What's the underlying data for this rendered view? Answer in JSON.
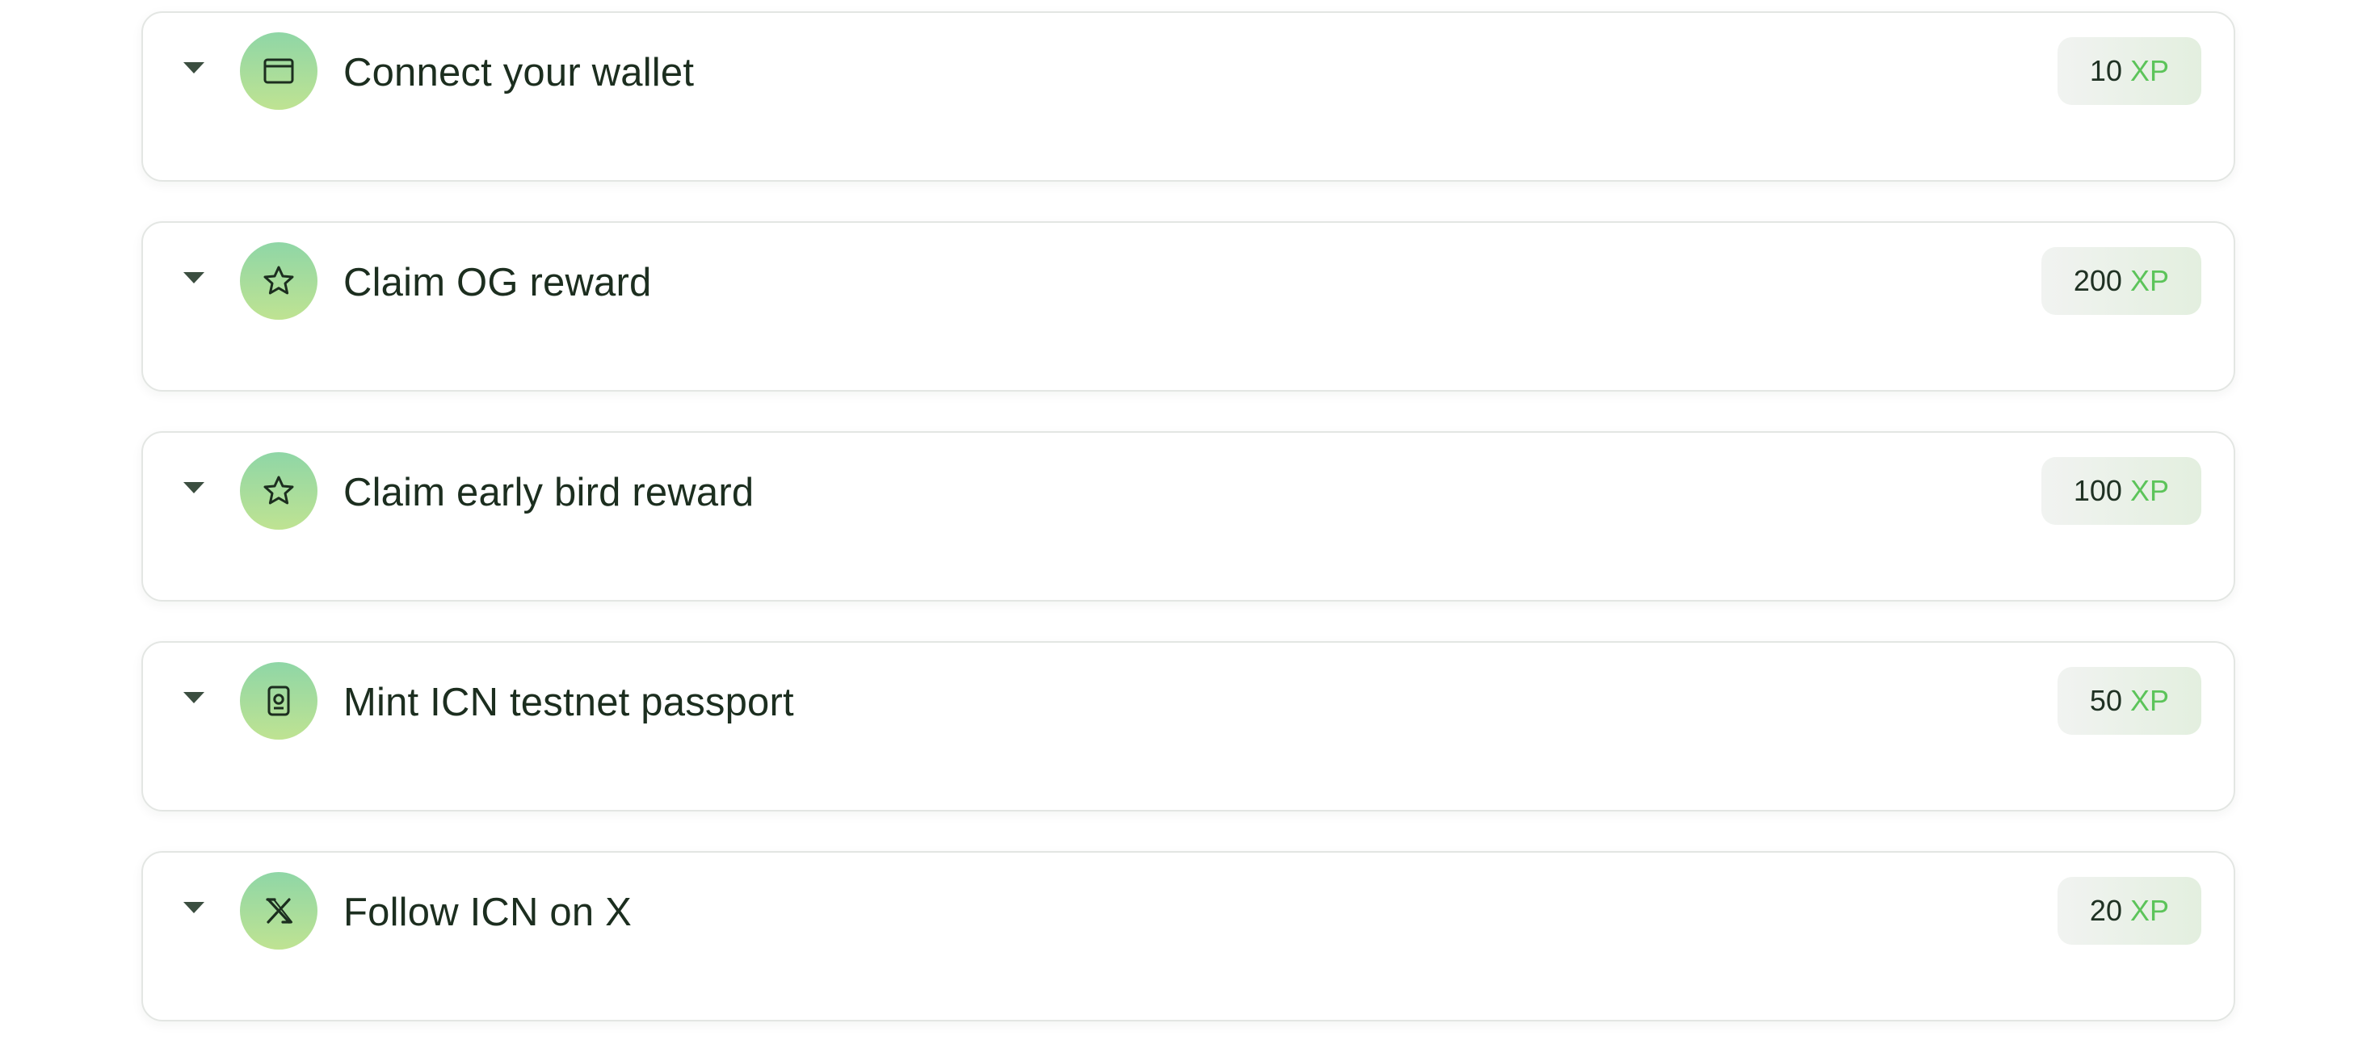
{
  "quests": [
    {
      "title": "Connect your wallet",
      "icon": "wallet-icon",
      "xp_amount": "10",
      "xp_unit": "XP"
    },
    {
      "title": "Claim OG reward",
      "icon": "star-icon",
      "xp_amount": "200",
      "xp_unit": "XP"
    },
    {
      "title": "Claim early bird reward",
      "icon": "star-icon",
      "xp_amount": "100",
      "xp_unit": "XP"
    },
    {
      "title": "Mint ICN testnet passport",
      "icon": "passport-icon",
      "xp_amount": "50",
      "xp_unit": "XP"
    },
    {
      "title": "Follow ICN on X",
      "icon": "x-logo-icon",
      "xp_amount": "20",
      "xp_unit": "XP"
    }
  ],
  "colors": {
    "accent_green": "#5cc45a",
    "text_dark": "#1c2e1f",
    "card_border": "#e3e6e3",
    "avatar_gradient_top": "#8fd6a6",
    "avatar_gradient_bottom": "#bfe392"
  }
}
